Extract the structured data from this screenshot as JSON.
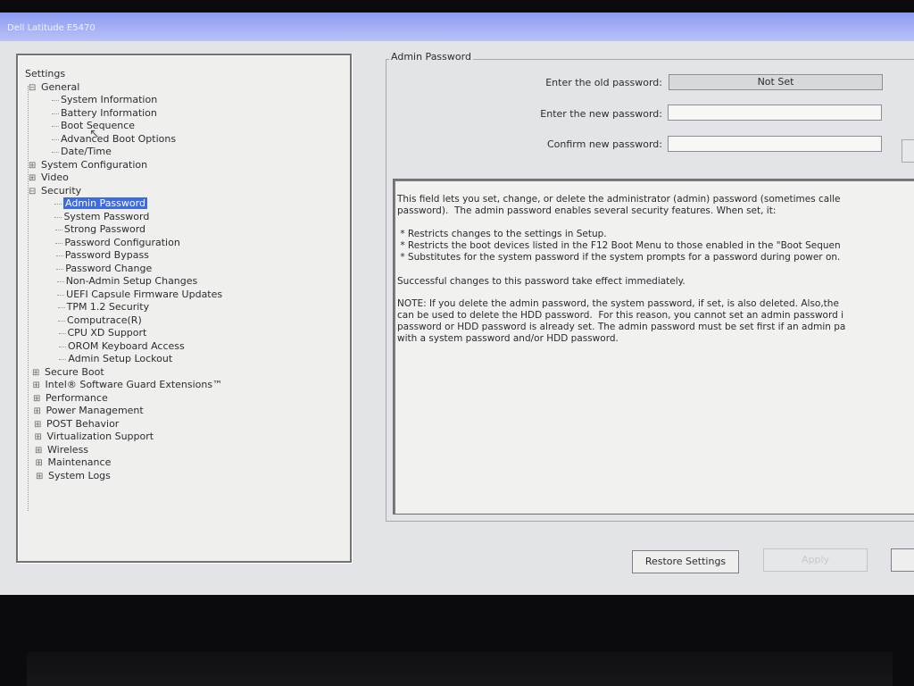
{
  "window": {
    "title": "Dell Latitude E5470"
  },
  "tree": {
    "items": [
      {
        "label": "Settings",
        "level": 0,
        "toggle": ""
      },
      {
        "label": "General",
        "level": 1,
        "toggle": "⊟"
      },
      {
        "label": "System Information",
        "level": 2,
        "toggle": ""
      },
      {
        "label": "Battery Information",
        "level": 2,
        "toggle": ""
      },
      {
        "label": "Boot Sequence",
        "level": 2,
        "toggle": ""
      },
      {
        "label": "Advanced Boot Options",
        "level": 2,
        "toggle": ""
      },
      {
        "label": "Date/Time",
        "level": 2,
        "toggle": ""
      },
      {
        "label": "System Configuration",
        "level": 1,
        "toggle": "⊞"
      },
      {
        "label": "Video",
        "level": 1,
        "toggle": "⊞"
      },
      {
        "label": "Security",
        "level": 1,
        "toggle": "⊟"
      },
      {
        "label": "Admin Password",
        "level": 2,
        "toggle": "",
        "selected": true
      },
      {
        "label": "System Password",
        "level": 2,
        "toggle": ""
      },
      {
        "label": "Strong Password",
        "level": 2,
        "toggle": ""
      },
      {
        "label": "Password Configuration",
        "level": 2,
        "toggle": ""
      },
      {
        "label": "Password Bypass",
        "level": 2,
        "toggle": ""
      },
      {
        "label": "Password Change",
        "level": 2,
        "toggle": ""
      },
      {
        "label": "Non-Admin Setup Changes",
        "level": 2,
        "toggle": ""
      },
      {
        "label": "UEFI Capsule Firmware Updates",
        "level": 2,
        "toggle": ""
      },
      {
        "label": "TPM 1.2 Security",
        "level": 2,
        "toggle": ""
      },
      {
        "label": "Computrace(R)",
        "level": 2,
        "toggle": ""
      },
      {
        "label": "CPU XD Support",
        "level": 2,
        "toggle": ""
      },
      {
        "label": "OROM Keyboard Access",
        "level": 2,
        "toggle": ""
      },
      {
        "label": "Admin Setup Lockout",
        "level": 2,
        "toggle": ""
      },
      {
        "label": "Secure Boot",
        "level": 1,
        "toggle": "⊞"
      },
      {
        "label": "Intel® Software Guard Extensions™",
        "level": 1,
        "toggle": "⊞"
      },
      {
        "label": "Performance",
        "level": 1,
        "toggle": "⊞"
      },
      {
        "label": "Power Management",
        "level": 1,
        "toggle": "⊞"
      },
      {
        "label": "POST Behavior",
        "level": 1,
        "toggle": "⊞"
      },
      {
        "label": "Virtualization Support",
        "level": 1,
        "toggle": "⊞"
      },
      {
        "label": "Wireless",
        "level": 1,
        "toggle": "⊞"
      },
      {
        "label": "Maintenance",
        "level": 1,
        "toggle": "⊞"
      },
      {
        "label": "System Logs",
        "level": 1,
        "toggle": "⊞"
      }
    ]
  },
  "admin_password": {
    "group_title": "Admin Password",
    "old_label": "Enter the old password:",
    "old_value": "Not Set",
    "new_label": "Enter the new password:",
    "new_value": "",
    "confirm_label": "Confirm new password:",
    "confirm_value": ""
  },
  "help": {
    "p1": "This field lets you set, change, or delete the administrator (admin) password (sometimes calle\npassword).  The admin password enables several security features. When set, it:",
    "p2": " * Restricts changes to the settings in Setup.\n * Restricts the boot devices listed in the F12 Boot Menu to those enabled in the \"Boot Sequen\n * Substitutes for the system password if the system prompts for a password during power on.",
    "p3": "Successful changes to this password take effect immediately.",
    "p4": "NOTE: If you delete the admin password, the system password, if set, is also deleted. Also,the\ncan be used to delete the HDD password.  For this reason, you cannot set an admin password i\npassword or HDD password is already set. The admin password must be set first if an admin pa\nwith a system password and/or HDD password."
  },
  "buttons": {
    "restore": "Restore Settings",
    "apply": "Apply"
  },
  "colors": {
    "title_bar": "#9aa6f3",
    "selection": "#3d6be0",
    "panel_bg": "#e3e4e8"
  }
}
